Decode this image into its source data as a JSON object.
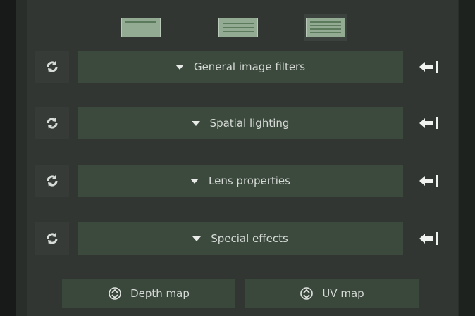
{
  "layout_modes": [
    {
      "icon": "single-row-layout-icon"
    },
    {
      "icon": "double-row-layout-icon"
    },
    {
      "icon": "multi-row-layout-icon",
      "active": true
    }
  ],
  "sections": [
    {
      "label": "General image filters",
      "reset_icon": "reset-cycle-icon",
      "dock_icon": "arrow-to-edge-icon"
    },
    {
      "label": "Spatial lighting",
      "reset_icon": "reset-cycle-icon",
      "dock_icon": "arrow-to-edge-icon"
    },
    {
      "label": "Lens properties",
      "reset_icon": "reset-cycle-icon",
      "dock_icon": "arrow-to-edge-icon"
    },
    {
      "label": "Special effects",
      "reset_icon": "reset-cycle-icon",
      "dock_icon": "arrow-to-edge-icon"
    }
  ],
  "maps": {
    "depth_label": "Depth map",
    "uv_label": "UV map"
  },
  "colors": {
    "background": "#313632",
    "section_bar": "#3c4a3e",
    "accent_green": "#93aa93",
    "text": "#d6dad6"
  }
}
